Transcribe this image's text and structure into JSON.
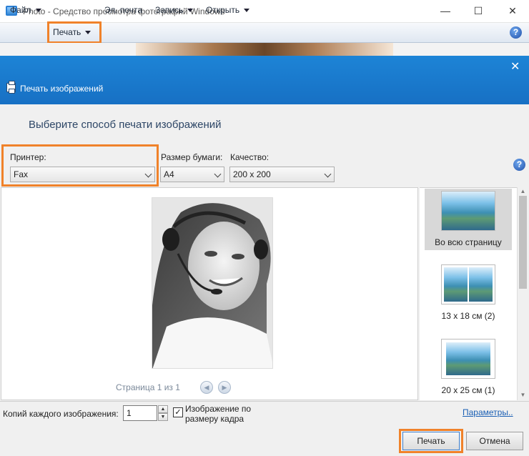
{
  "window": {
    "title": "Photo - Средство просмотра фотографий Windows",
    "minimize_glyph": "—",
    "maximize_glyph": "☐",
    "close_glyph": "✕"
  },
  "menu": {
    "items": [
      {
        "label": "Файл",
        "has_dropdown": true
      },
      {
        "label": "Печать",
        "has_dropdown": true,
        "highlighted": true
      },
      {
        "label": "Эл. почта",
        "has_dropdown": false
      },
      {
        "label": "Запись",
        "has_dropdown": true
      },
      {
        "label": "Открыть",
        "has_dropdown": true
      }
    ],
    "help_glyph": "?"
  },
  "dialog": {
    "title": "Печать изображений",
    "close_glyph": "✕",
    "heading": "Выберите способ печати изображений",
    "help_glyph": "?",
    "printer": {
      "label": "Принтер:",
      "value": "Fax"
    },
    "paper": {
      "label": "Размер бумаги:",
      "value": "A4"
    },
    "quality": {
      "label": "Качество:",
      "value": "200 x 200"
    },
    "page_info": "Страница 1 из 1",
    "prev_glyph": "◀",
    "next_glyph": "▶",
    "layouts": [
      {
        "label": "Во всю страницу",
        "selected": true
      },
      {
        "label": "13 x 18 см (2)",
        "selected": false
      },
      {
        "label": "20 x 25 см (1)",
        "selected": false
      }
    ],
    "copies_label": "Копий каждого изображения:",
    "copies_value": "1",
    "fit_checked": true,
    "fit_label": "Изображение по размеру кадра",
    "params_link": "Параметры..",
    "print_button": "Печать",
    "cancel_button": "Отмена"
  },
  "colors": {
    "accent_highlight": "#f0822a",
    "dialog_header": "#1770c4",
    "link": "#1a5fb4"
  }
}
